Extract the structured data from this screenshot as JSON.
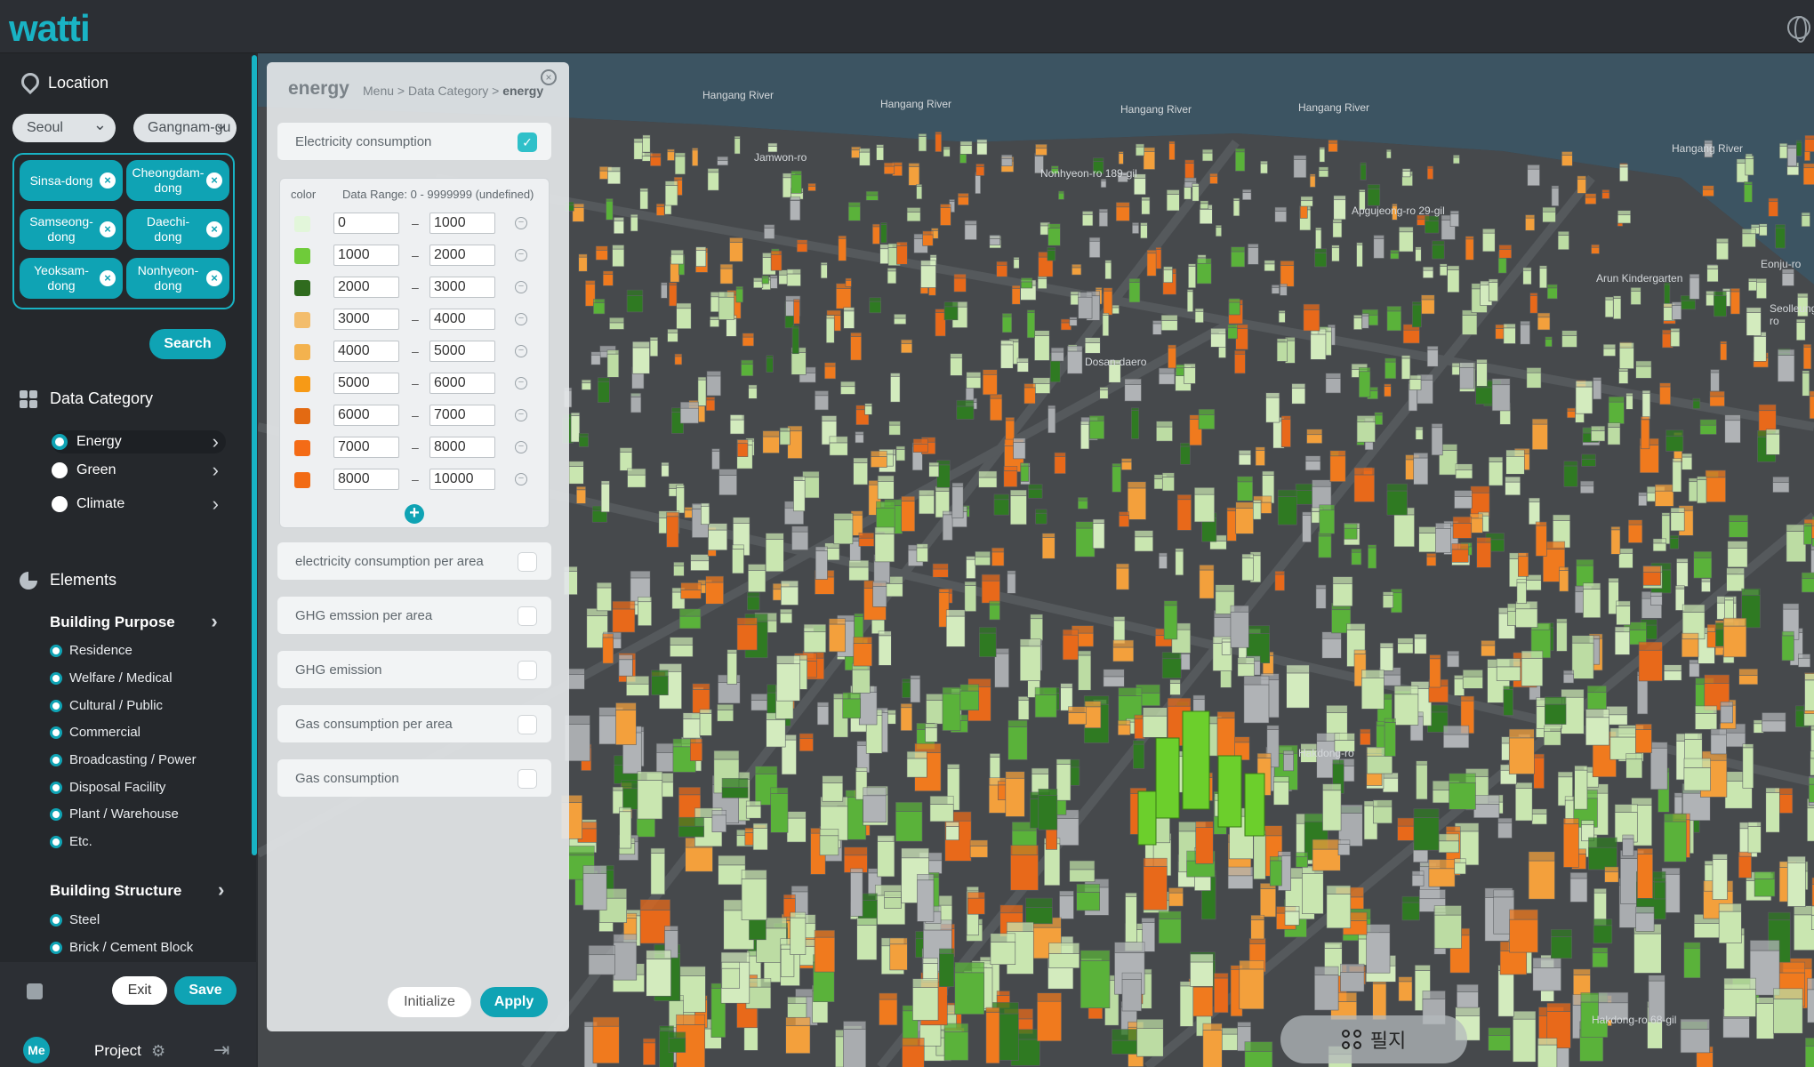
{
  "app": {
    "logo": "watti"
  },
  "sidebar": {
    "location": {
      "title": "Location",
      "city": "Seoul",
      "district": "Gangnam-gu",
      "dongs": [
        "Sinsa-dong",
        "Cheongdam-dong",
        "Samseong-dong",
        "Daechi-dong",
        "Yeoksam-dong",
        "Nonhyeon-dong"
      ],
      "search_label": "Search"
    },
    "data_category": {
      "title": "Data Category",
      "items": [
        {
          "label": "Energy",
          "selected": true
        },
        {
          "label": "Green",
          "selected": false
        },
        {
          "label": "Climate",
          "selected": false
        }
      ]
    },
    "elements": {
      "title": "Elements",
      "building_purpose": {
        "label": "Building Purpose",
        "items": [
          "Residence",
          "Welfare / Medical",
          "Cultural / Public",
          "Commercial",
          "Broadcasting / Power",
          "Disposal Facility",
          "Plant / Warehouse",
          "Etc."
        ]
      },
      "building_structure": {
        "label": "Building Structure",
        "items": [
          "Steel",
          "Brick / Cement Block"
        ]
      }
    },
    "footer": {
      "exit_label": "Exit",
      "save_label": "Save",
      "avatar": "Me",
      "project_label": "Project"
    }
  },
  "panel": {
    "title": "energy",
    "breadcrumb_prefix": "Menu > Data Category > ",
    "breadcrumb_current": "energy",
    "selected_metric": {
      "label": "Electricity consumption",
      "checked": true
    },
    "range_header": "color",
    "range_note": "Data Range: 0 - 9999999 (undefined)",
    "ranges": [
      {
        "color": "#e2f6da",
        "min": "0",
        "max": "1000"
      },
      {
        "color": "#6fcb3a",
        "min": "1000",
        "max": "2000"
      },
      {
        "color": "#2f6b1e",
        "min": "2000",
        "max": "3000"
      },
      {
        "color": "#f3bd6c",
        "min": "3000",
        "max": "4000"
      },
      {
        "color": "#f3b24e",
        "min": "4000",
        "max": "5000"
      },
      {
        "color": "#f79a16",
        "min": "5000",
        "max": "6000"
      },
      {
        "color": "#e36a12",
        "min": "6000",
        "max": "7000"
      },
      {
        "color": "#f46b16",
        "min": "7000",
        "max": "8000"
      },
      {
        "color": "#f26b14",
        "min": "8000",
        "max": "10000"
      }
    ],
    "other_metrics": [
      {
        "label": "electricity consumption per area",
        "checked": false
      },
      {
        "label": "GHG emssion per area",
        "checked": false
      },
      {
        "label": "GHG emission",
        "checked": false
      },
      {
        "label": "Gas consumption per area",
        "checked": false
      },
      {
        "label": "Gas consumption",
        "checked": false
      }
    ],
    "initialize_label": "Initialize",
    "apply_label": "Apply"
  },
  "map": {
    "labels": [
      "Hangang River",
      "Hangang River",
      "Hangang River",
      "Hangang River",
      "Hangang River",
      "Jamwon-ro",
      "Nonhyeon-ro 189-gil",
      "Apgujeong-ro 29-gil",
      "Dosan-daero",
      "Eonju-ro",
      "Seolleung-ro",
      "Arun Kindergarten",
      "Hakdong-ro",
      "Hakdong-ro 68-gil"
    ],
    "filter_label": "필지"
  },
  "colors": {
    "accent": "#0fa3b4",
    "sidebar_bg": "#25282c"
  }
}
